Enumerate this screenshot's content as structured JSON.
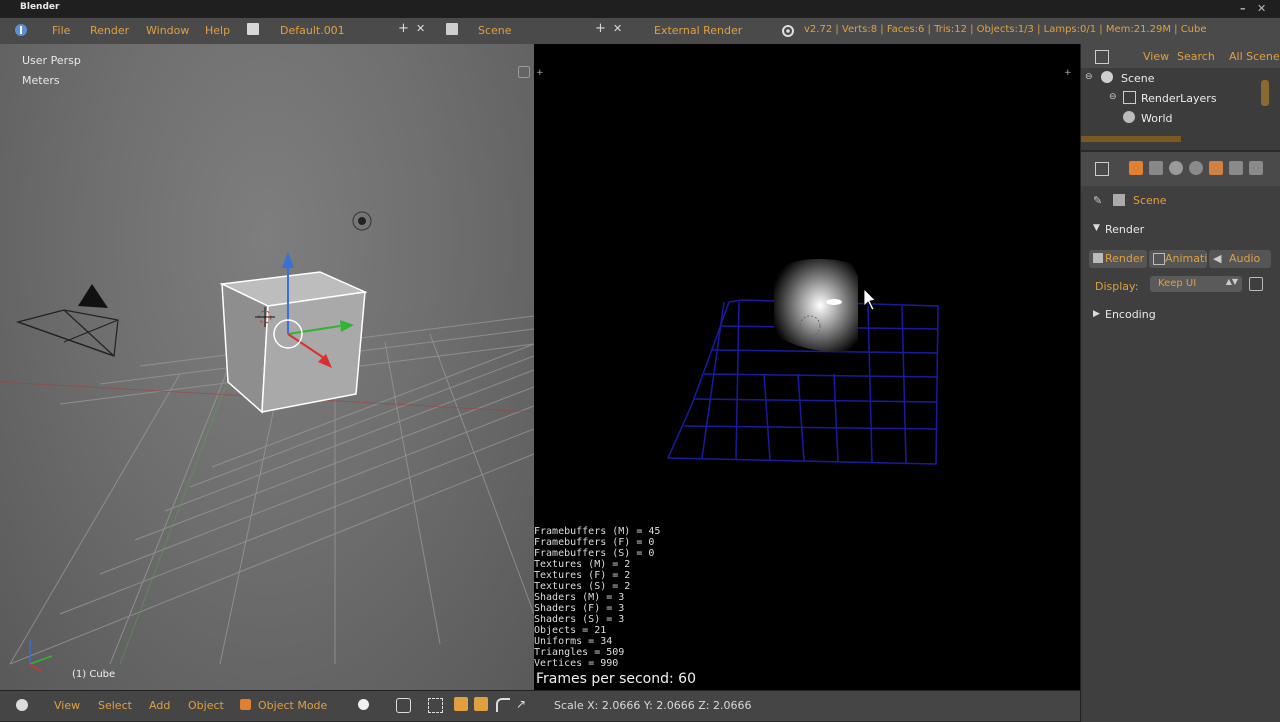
{
  "window": {
    "title": "Blender"
  },
  "topbar": {
    "menus": [
      "File",
      "Render",
      "Window",
      "Help"
    ],
    "screen_layout": "Default.001",
    "scene": "Scene",
    "engine": "External Render",
    "stats": "v2.72 | Verts:8 | Faces:6 | Tris:12 | Objects:1/3 | Lamps:0/1 | Mem:21.29M | Cube"
  },
  "viewport": {
    "view_label": "User Persp",
    "units_label": "Meters",
    "object_label": "(1) Cube",
    "header": {
      "items": [
        "View",
        "Select",
        "Add",
        "Object"
      ],
      "mode": "Object Mode"
    }
  },
  "render_view": {
    "stats_lines": [
      "Framebuffers (M) = 45",
      "Framebuffers (F) = 0",
      "Framebuffers (S) = 0",
      "Textures (M) = 2",
      "Textures (F) = 2",
      "Textures (S) = 2",
      "Shaders (M) = 3",
      "Shaders (F) = 3",
      "Shaders (S) = 3",
      "Objects = 21",
      "Uniforms = 34",
      "Triangles = 509",
      "Vertices = 990"
    ],
    "fps_text": "Frames per second: 60",
    "scale_text": "Scale X: 2.0666  Y: 2.0666  Z: 2.0666"
  },
  "outliner": {
    "header_items": [
      "View",
      "Search",
      "All Scenes"
    ],
    "tree": [
      "Scene",
      "RenderLayers",
      "World"
    ]
  },
  "properties": {
    "context": "Scene",
    "panel_title": "Render",
    "buttons": [
      "Render",
      "Animation",
      "Audio"
    ],
    "display_label": "Display:",
    "display_value": "Keep UI",
    "encoding_label": "Encoding"
  },
  "colors": {
    "accent": "#e0a040",
    "viewport_bg": "#727272",
    "render_bg": "#000000",
    "grid_blue": "#1a1aa0"
  }
}
